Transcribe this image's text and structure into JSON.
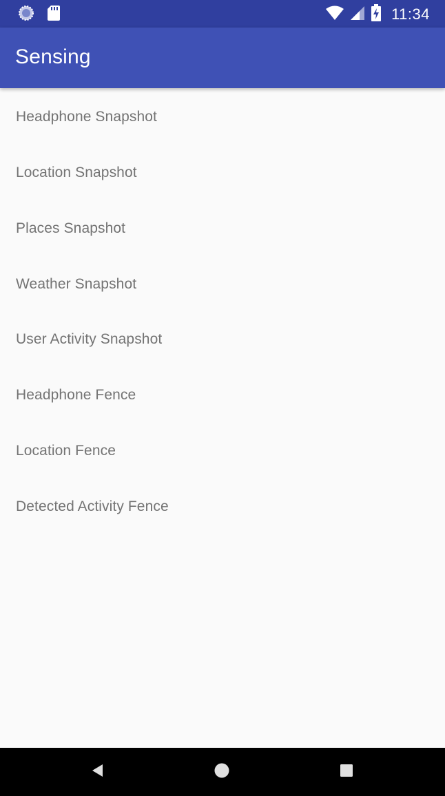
{
  "status_bar": {
    "time": "11:34",
    "icons": [
      "loading-icon",
      "sd-card-icon",
      "wifi-icon",
      "signal-icon",
      "battery-charging-icon"
    ],
    "background": "#303f9f"
  },
  "app_bar": {
    "title": "Sensing",
    "background": "#3f51b5"
  },
  "menu": {
    "items": [
      {
        "label": "Headphone Snapshot"
      },
      {
        "label": "Location Snapshot"
      },
      {
        "label": "Places Snapshot"
      },
      {
        "label": "Weather Snapshot"
      },
      {
        "label": "User Activity Snapshot"
      },
      {
        "label": "Headphone Fence"
      },
      {
        "label": "Location Fence"
      },
      {
        "label": "Detected Activity Fence"
      }
    ],
    "text_color": "#737373",
    "background": "#fafafa"
  },
  "nav_bar": {
    "buttons": [
      "back-icon",
      "home-icon",
      "recents-icon"
    ],
    "background": "#000000",
    "icon_color": "#e0e0e0"
  }
}
